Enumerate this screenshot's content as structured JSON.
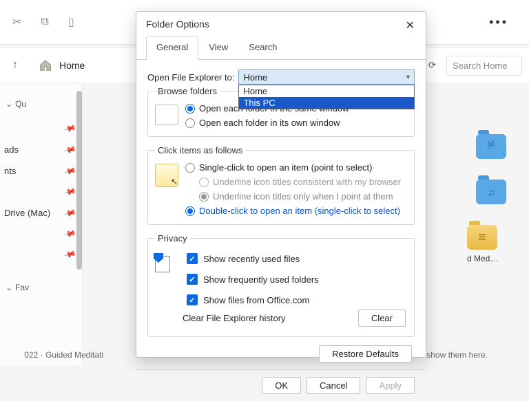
{
  "toolbar": {
    "dots": "•••"
  },
  "nav": {
    "home": "Home",
    "search_placeholder": "Search Home"
  },
  "sidebar": {
    "quick": "Qu",
    "items": [
      "",
      "ads",
      "nts",
      "",
      "Drive (Mac)",
      "",
      ""
    ],
    "fav": "Fav"
  },
  "right": {
    "med_label": "d Med…",
    "bottom_right": "we'll show them here.",
    "bottom_left": "022 · Guided Meditati"
  },
  "dialog": {
    "title": "Folder Options",
    "tabs": {
      "general": "General",
      "view": "View",
      "search": "Search"
    },
    "open_label": "Open File Explorer to:",
    "select": {
      "selected": "Home",
      "opt1": "Home",
      "opt2": "This PC"
    },
    "browse": {
      "legend": "Browse folders",
      "same": "Open each folder in the same window",
      "own": "Open each folder in its own window"
    },
    "click": {
      "legend": "Click items as follows",
      "single": "Single-click to open an item (point to select)",
      "underline1": "Underline icon titles consistent with my browser",
      "underline2": "Underline icon titles only when I point at them",
      "double": "Double-click to open an item (single-click to select)"
    },
    "privacy": {
      "legend": "Privacy",
      "recent": "Show recently used files",
      "frequent": "Show frequently used folders",
      "office": "Show files from Office.com",
      "clear_label": "Clear File Explorer history",
      "clear_btn": "Clear"
    },
    "restore": "Restore Defaults",
    "ok": "OK",
    "cancel": "Cancel",
    "apply": "Apply"
  }
}
